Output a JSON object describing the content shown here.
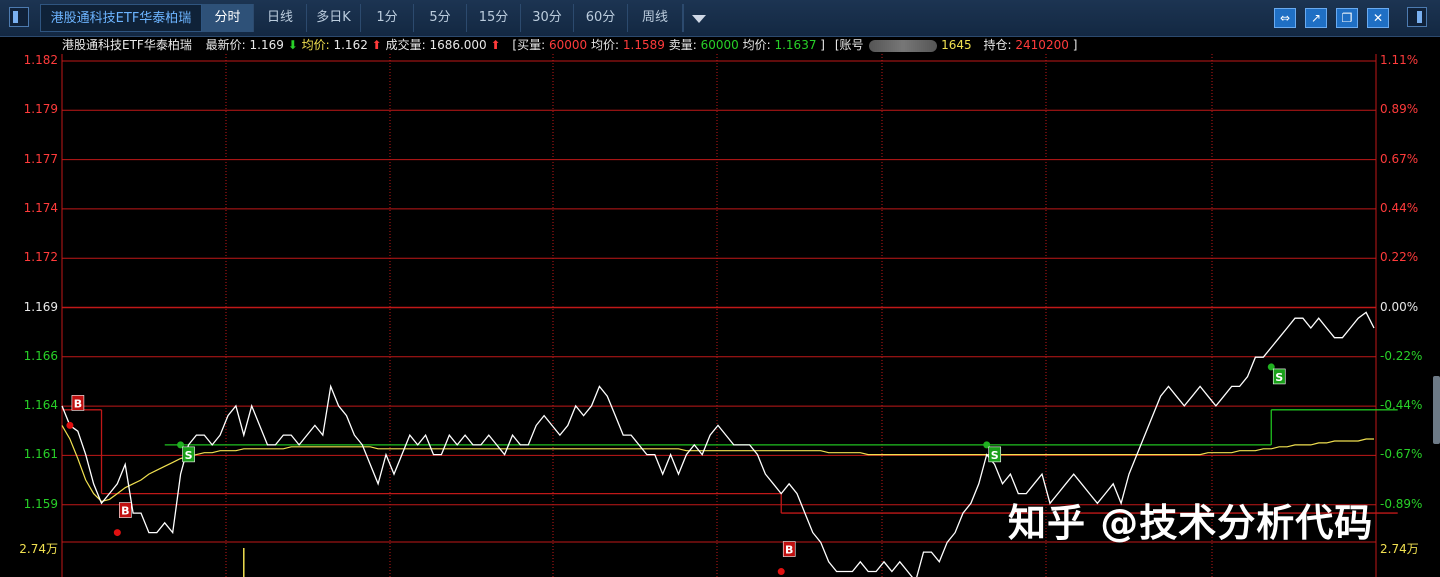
{
  "toolbar": {
    "security_name": "港股通科技ETF华泰柏瑞",
    "period_tabs": [
      "分时",
      "日线",
      "多日K",
      "1分",
      "5分",
      "15分",
      "30分",
      "60分",
      "周线"
    ],
    "active_tab": "分时",
    "tool_icons": [
      "link-icon",
      "export-icon",
      "window-icon",
      "close-icon"
    ]
  },
  "info": {
    "name": "港股通科技ETF华泰柏瑞",
    "latest_label": "最新价:",
    "latest_value": "1.169",
    "avg_label": "均价:",
    "avg_value": "1.162",
    "volume_label": "成交量:",
    "volume_value": "1686.000",
    "buy_label": "[买量:",
    "buy_qty": "60000",
    "buy_avg_label": "均价:",
    "buy_avg": "1.1589",
    "sell_label": "卖量:",
    "sell_qty": "60000",
    "sell_avg_label": "均价:",
    "sell_avg": "1.1637",
    "close_bracket": "]",
    "account_label": "[账号",
    "account_tail": "1645",
    "position_label": "持仓:",
    "position_value": "2410200",
    "end_bracket": "]"
  },
  "axis": {
    "left_ticks": [
      "1.182",
      "1.179",
      "1.177",
      "1.174",
      "1.172",
      "1.169",
      "1.166",
      "1.164",
      "1.161",
      "1.159"
    ],
    "right_ticks": [
      "1.11%",
      "0.89%",
      "0.67%",
      "0.44%",
      "0.22%",
      "0.00%",
      "-0.22%",
      "-0.44%",
      "-0.67%",
      "-0.89%"
    ],
    "volume_left": "2.74万",
    "volume_right": "2.74万"
  },
  "chart_data": {
    "type": "line",
    "title": "",
    "ylim": [
      1.157,
      1.183
    ],
    "prev_close": 1.169,
    "price": [
      1.1645,
      1.1635,
      1.1632,
      1.162,
      1.1605,
      1.1595,
      1.16,
      1.1605,
      1.1615,
      1.159,
      1.159,
      1.158,
      1.158,
      1.1585,
      1.158,
      1.161,
      1.1625,
      1.163,
      1.163,
      1.1625,
      1.163,
      1.164,
      1.1645,
      1.163,
      1.1645,
      1.1635,
      1.1625,
      1.1625,
      1.163,
      1.163,
      1.1625,
      1.163,
      1.1635,
      1.163,
      1.1655,
      1.1645,
      1.164,
      1.163,
      1.1625,
      1.1615,
      1.1605,
      1.162,
      1.161,
      1.162,
      1.163,
      1.1625,
      1.163,
      1.162,
      1.162,
      1.163,
      1.1625,
      1.163,
      1.1625,
      1.1625,
      1.163,
      1.1625,
      1.162,
      1.163,
      1.1625,
      1.1625,
      1.1635,
      1.164,
      1.1635,
      1.163,
      1.1635,
      1.1645,
      1.164,
      1.1645,
      1.1655,
      1.165,
      1.164,
      1.163,
      1.163,
      1.1625,
      1.162,
      1.162,
      1.161,
      1.162,
      1.161,
      1.162,
      1.1625,
      1.162,
      1.163,
      1.1635,
      1.163,
      1.1625,
      1.1625,
      1.1625,
      1.162,
      1.161,
      1.1605,
      1.16,
      1.1605,
      1.16,
      1.159,
      1.158,
      1.1575,
      1.1565,
      1.156,
      1.156,
      1.156,
      1.1565,
      1.156,
      1.156,
      1.1565,
      1.156,
      1.1565,
      1.156,
      1.1555,
      1.157,
      1.157,
      1.1565,
      1.1575,
      1.158,
      1.159,
      1.1595,
      1.1605,
      1.162,
      1.1615,
      1.1605,
      1.161,
      1.16,
      1.16,
      1.1605,
      1.161,
      1.1595,
      1.16,
      1.1605,
      1.161,
      1.1605,
      1.16,
      1.1595,
      1.16,
      1.1605,
      1.1595,
      1.161,
      1.162,
      1.163,
      1.164,
      1.165,
      1.1655,
      1.165,
      1.1645,
      1.165,
      1.1655,
      1.165,
      1.1645,
      1.165,
      1.1655,
      1.1655,
      1.166,
      1.167,
      1.167,
      1.1675,
      1.168,
      1.1685,
      1.169,
      1.169,
      1.1685,
      1.169,
      1.1685,
      1.168,
      1.168,
      1.1685,
      1.169,
      1.1693,
      1.1685
    ],
    "avg_price": [
      1.1635,
      1.1628,
      1.1618,
      1.1607,
      1.16,
      1.1596,
      1.1597,
      1.16,
      1.1603,
      1.1605,
      1.1607,
      1.161,
      1.1612,
      1.1614,
      1.1616,
      1.1618,
      1.1619,
      1.162,
      1.1621,
      1.1621,
      1.1622,
      1.1622,
      1.1622,
      1.1623,
      1.1623,
      1.1623,
      1.1623,
      1.1623,
      1.1623,
      1.1624,
      1.1624,
      1.1624,
      1.1624,
      1.1624,
      1.1624,
      1.1624,
      1.1624,
      1.1624,
      1.1624,
      1.1624,
      1.1623,
      1.1623,
      1.1623,
      1.1623,
      1.1623,
      1.1623,
      1.1623,
      1.1623,
      1.1623,
      1.1623,
      1.1623,
      1.1623,
      1.1623,
      1.1623,
      1.1623,
      1.1623,
      1.1623,
      1.1623,
      1.1623,
      1.1623,
      1.1623,
      1.1623,
      1.1623,
      1.1623,
      1.1623,
      1.1623,
      1.1623,
      1.1623,
      1.1623,
      1.1623,
      1.1623,
      1.1623,
      1.1623,
      1.1623,
      1.1623,
      1.1623,
      1.1623,
      1.1623,
      1.1623,
      1.1622,
      1.1622,
      1.1622,
      1.1622,
      1.1622,
      1.1622,
      1.1622,
      1.1622,
      1.1622,
      1.1622,
      1.1622,
      1.1622,
      1.1622,
      1.1622,
      1.1622,
      1.1622,
      1.1622,
      1.1622,
      1.1621,
      1.1621,
      1.1621,
      1.1621,
      1.1621,
      1.162,
      1.162,
      1.162,
      1.162,
      1.162,
      1.162,
      1.162,
      1.162,
      1.162,
      1.162,
      1.162,
      1.162,
      1.162,
      1.162,
      1.162,
      1.162,
      1.162,
      1.162,
      1.162,
      1.162,
      1.162,
      1.162,
      1.162,
      1.162,
      1.162,
      1.162,
      1.162,
      1.162,
      1.162,
      1.162,
      1.162,
      1.162,
      1.162,
      1.162,
      1.162,
      1.162,
      1.162,
      1.162,
      1.162,
      1.162,
      1.162,
      1.162,
      1.162,
      1.1621,
      1.1621,
      1.1621,
      1.1621,
      1.1622,
      1.1622,
      1.1622,
      1.1623,
      1.1623,
      1.1624,
      1.1624,
      1.1625,
      1.1625,
      1.1625,
      1.1626,
      1.1626,
      1.1627,
      1.1627,
      1.1627,
      1.1627,
      1.1628,
      1.1628
    ],
    "trades": [
      {
        "label": "B",
        "side": "buy",
        "index": 1,
        "price": 1.1635
      },
      {
        "label": "B",
        "side": "buy",
        "index": 7,
        "price": 1.158
      },
      {
        "label": "S",
        "side": "sell",
        "index": 15,
        "price": 1.1625
      },
      {
        "label": "B",
        "side": "buy",
        "index": 91,
        "price": 1.156
      },
      {
        "label": "S",
        "side": "sell",
        "index": 117,
        "price": 1.1625
      },
      {
        "label": "S",
        "side": "sell",
        "index": 153,
        "price": 1.1665
      }
    ],
    "ref_lines": [
      {
        "color": "#c01818",
        "price": 1.1643,
        "from": 0,
        "to": 5
      },
      {
        "color": "#c01818",
        "price": 1.16,
        "from": 5,
        "to": 91
      },
      {
        "color": "#c01818",
        "price": 1.159,
        "from": 91,
        "to": 169
      },
      {
        "color": "#20c020",
        "price": 1.1625,
        "from": 13,
        "to": 153
      },
      {
        "color": "#20c020",
        "price": 1.1643,
        "from": 153,
        "to": 169
      }
    ],
    "volume_bar": {
      "index": 23,
      "fraction": 1.0
    }
  },
  "watermark": "知乎 @技术分析代码",
  "colors": {
    "background": "#000000",
    "grid": "#c01818",
    "price_line": "#ffffff",
    "avg_line": "#f0e050",
    "up": "#ff3b3b",
    "down": "#28d028",
    "toolbar": "#132842",
    "tool_button": "#1f6fc4"
  }
}
